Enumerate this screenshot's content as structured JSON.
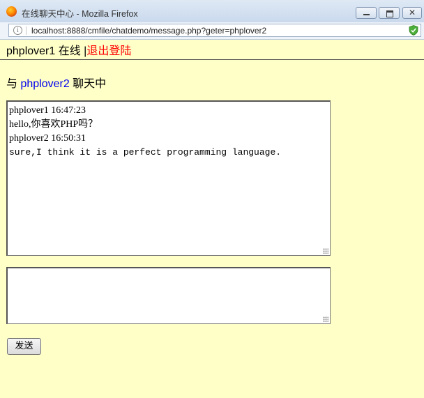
{
  "window": {
    "title": "在线聊天中心 - Mozilla Firefox",
    "url": "localhost:8888/cmfile/chatdemo/message.php?geter=phplover2"
  },
  "status": {
    "username": "phplover1",
    "online_text": " 在线 |",
    "logout_label": "退出登陆"
  },
  "chat_header": {
    "prefix": "与 ",
    "peer": "phplover2",
    "suffix": " 聊天中"
  },
  "messages": [
    {
      "header": "phplover1 16:47:23",
      "text": "hello,你喜欢PHP吗？"
    },
    {
      "header": "phplover2 16:50:31",
      "text": "sure,I think it is a perfect programming language."
    }
  ],
  "compose": {
    "value": "",
    "send_label": "发送"
  },
  "icons": {
    "browser": "firefox-icon",
    "site_info": "info-icon",
    "security": "shield-icon"
  }
}
